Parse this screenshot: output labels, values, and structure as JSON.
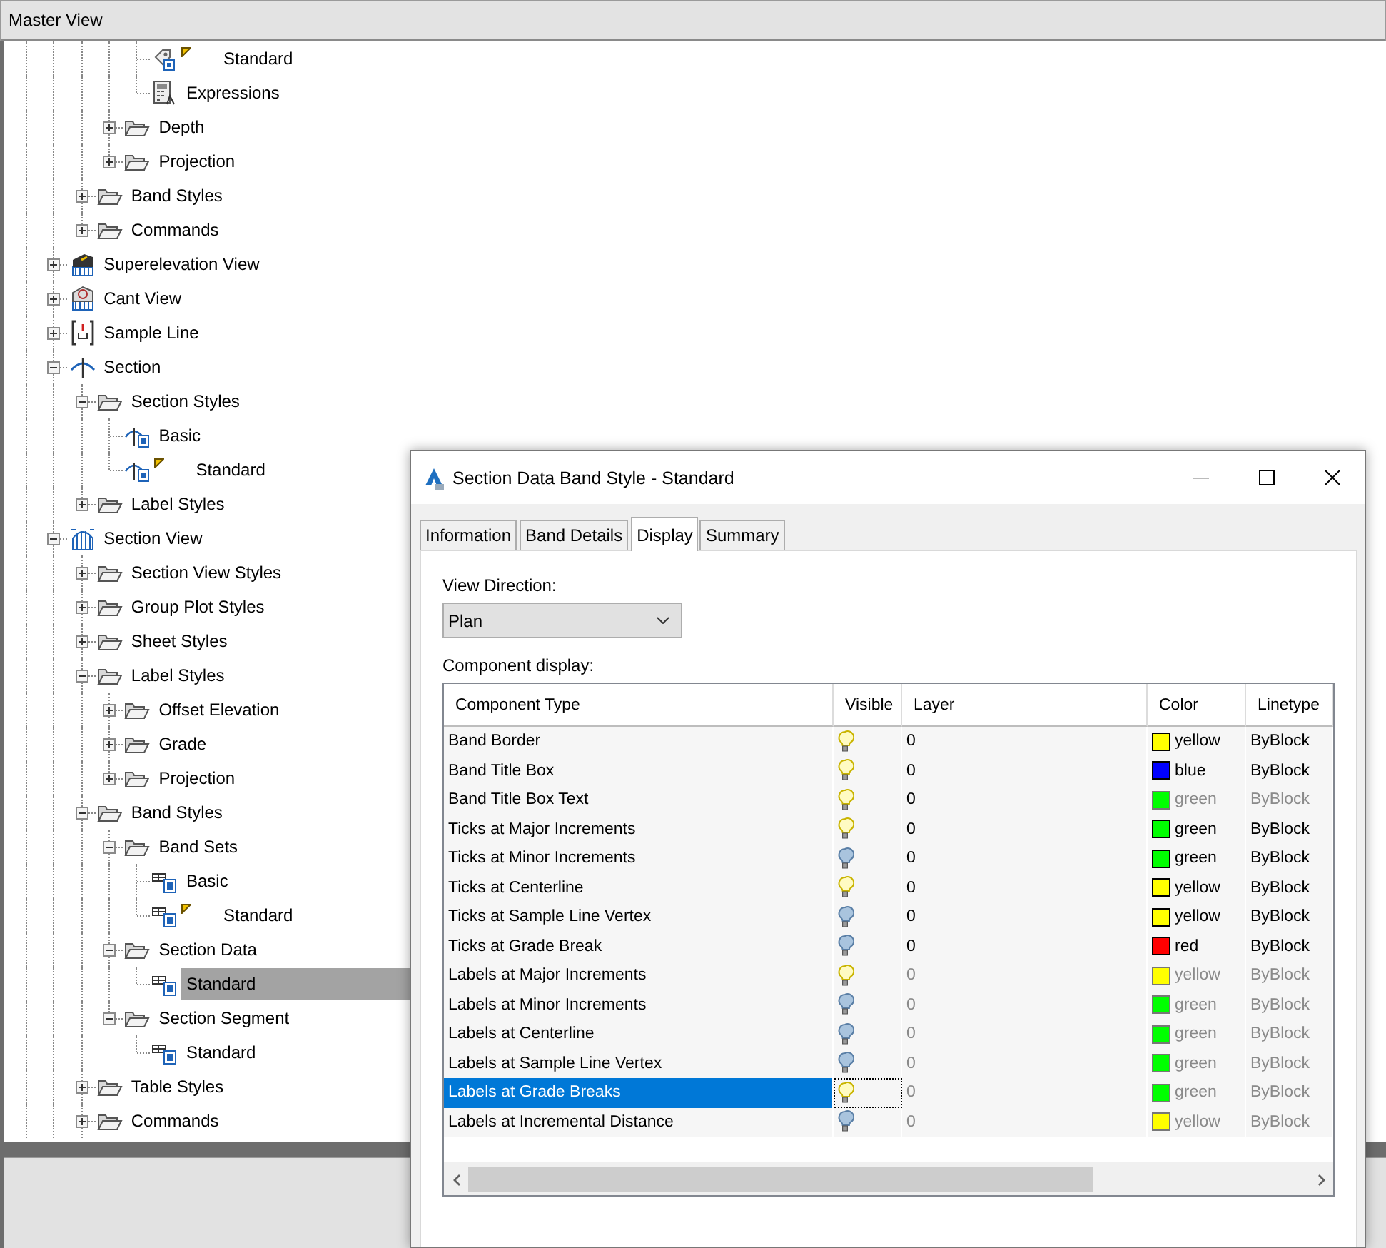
{
  "panel": {
    "title": "Master View"
  },
  "tree": {
    "items": [
      {
        "children": [
          {
            "children": [
              {
                "children": [
                  {
                    "label": "Standard",
                    "kind": "style",
                    "marked": true,
                    "selected": false
                  },
                  {
                    "label": "Expressions",
                    "kind": "expressions",
                    "marked": false,
                    "selected": false
                  }
                ]
              },
              {
                "label": "Depth",
                "kind": "folder",
                "expanded": false,
                "marked": false,
                "selected": false
              },
              {
                "label": "Projection",
                "kind": "folder",
                "expanded": false,
                "marked": false,
                "selected": false
              }
            ]
          },
          {
            "label": "Band Styles",
            "kind": "folder",
            "expanded": false,
            "marked": false,
            "selected": false
          },
          {
            "label": "Commands",
            "kind": "folder",
            "expanded": false,
            "marked": false,
            "selected": false
          }
        ]
      },
      {
        "label": "Superelevation View",
        "kind": "superelevation-view",
        "expanded": false,
        "marked": false,
        "selected": false
      },
      {
        "label": "Cant View",
        "kind": "cant-view",
        "expanded": false,
        "marked": false,
        "selected": false
      },
      {
        "label": "Sample Line",
        "kind": "sample-line",
        "expanded": false,
        "marked": false,
        "selected": false
      },
      {
        "label": "Section",
        "kind": "section",
        "expanded": true,
        "marked": false,
        "selected": false,
        "children": [
          {
            "label": "Section Styles",
            "kind": "folder",
            "expanded": true,
            "marked": false,
            "selected": false,
            "children": [
              {
                "label": "Basic",
                "kind": "section-style",
                "marked": false,
                "selected": false
              },
              {
                "label": "Standard",
                "kind": "section-style",
                "marked": true,
                "selected": false
              }
            ]
          },
          {
            "label": "Label Styles",
            "kind": "folder",
            "expanded": false,
            "marked": false,
            "selected": false
          }
        ]
      },
      {
        "label": "Section View",
        "kind": "section-view",
        "expanded": true,
        "marked": false,
        "selected": false,
        "children": [
          {
            "label": "Section View Styles",
            "kind": "folder",
            "expanded": false,
            "marked": false,
            "selected": false
          },
          {
            "label": "Group Plot Styles",
            "kind": "folder",
            "expanded": false,
            "marked": false,
            "selected": false
          },
          {
            "label": "Sheet Styles",
            "kind": "folder",
            "expanded": false,
            "marked": false,
            "selected": false
          },
          {
            "label": "Label Styles",
            "kind": "folder",
            "expanded": true,
            "marked": false,
            "selected": false,
            "children": [
              {
                "label": "Offset Elevation",
                "kind": "folder",
                "expanded": false,
                "marked": false,
                "selected": false
              },
              {
                "label": "Grade",
                "kind": "folder",
                "expanded": false,
                "marked": false,
                "selected": false
              },
              {
                "label": "Projection",
                "kind": "folder",
                "expanded": false,
                "marked": false,
                "selected": false
              }
            ]
          },
          {
            "label": "Band Styles",
            "kind": "folder",
            "expanded": true,
            "marked": false,
            "selected": false,
            "children": [
              {
                "label": "Band Sets",
                "kind": "folder",
                "expanded": true,
                "marked": false,
                "selected": false,
                "children": [
                  {
                    "label": "Basic",
                    "kind": "band-set",
                    "marked": false,
                    "selected": false
                  },
                  {
                    "label": "Standard",
                    "kind": "band-set",
                    "marked": true,
                    "selected": false
                  }
                ]
              },
              {
                "label": "Section Data",
                "kind": "folder",
                "expanded": true,
                "marked": false,
                "selected": false,
                "children": [
                  {
                    "label": "Standard",
                    "kind": "band-set",
                    "marked": false,
                    "selected": true
                  }
                ]
              },
              {
                "label": "Section Segment",
                "kind": "folder",
                "expanded": true,
                "marked": false,
                "selected": false,
                "children": [
                  {
                    "label": "Standard",
                    "kind": "band-set",
                    "marked": false,
                    "selected": false
                  }
                ]
              }
            ]
          },
          {
            "label": "Table Styles",
            "kind": "folder",
            "expanded": false,
            "marked": false,
            "selected": false
          },
          {
            "label": "Commands",
            "kind": "folder",
            "expanded": false,
            "marked": false,
            "selected": false
          }
        ]
      }
    ]
  },
  "dialog": {
    "title": "Section Data Band Style - Standard",
    "tabs": [
      {
        "label": "Information",
        "selected": false
      },
      {
        "label": "Band Details",
        "selected": false
      },
      {
        "label": "Display",
        "selected": true
      },
      {
        "label": "Summary",
        "selected": false
      }
    ],
    "view_direction": {
      "label": "View Direction:",
      "value": "Plan"
    },
    "component_display": {
      "label": "Component display:",
      "columns": [
        "Component Type",
        "Visible",
        "Layer",
        "Color",
        "Linetype"
      ],
      "rows": [
        {
          "name": "Band Border",
          "visible": true,
          "layer": "0",
          "color_name": "yellow",
          "color": "#ffff00",
          "linetype": "ByBlock",
          "layer_disabled": false,
          "properties_disabled": false,
          "selected": false
        },
        {
          "name": "Band Title Box",
          "visible": true,
          "layer": "0",
          "color_name": "blue",
          "color": "#0000ff",
          "linetype": "ByBlock",
          "layer_disabled": false,
          "properties_disabled": false,
          "selected": false
        },
        {
          "name": "Band Title Box Text",
          "visible": true,
          "layer": "0",
          "color_name": "green",
          "color": "#00ff00",
          "linetype": "ByBlock",
          "layer_disabled": false,
          "properties_disabled": true,
          "selected": false
        },
        {
          "name": "Ticks at Major Increments",
          "visible": true,
          "layer": "0",
          "color_name": "green",
          "color": "#00ff00",
          "linetype": "ByBlock",
          "layer_disabled": false,
          "properties_disabled": false,
          "selected": false
        },
        {
          "name": "Ticks at Minor Increments",
          "visible": false,
          "layer": "0",
          "color_name": "green",
          "color": "#00ff00",
          "linetype": "ByBlock",
          "layer_disabled": false,
          "properties_disabled": false,
          "selected": false
        },
        {
          "name": "Ticks at Centerline",
          "visible": true,
          "layer": "0",
          "color_name": "yellow",
          "color": "#ffff00",
          "linetype": "ByBlock",
          "layer_disabled": false,
          "properties_disabled": false,
          "selected": false
        },
        {
          "name": "Ticks at Sample Line Vertex",
          "visible": false,
          "layer": "0",
          "color_name": "yellow",
          "color": "#ffff00",
          "linetype": "ByBlock",
          "layer_disabled": false,
          "properties_disabled": false,
          "selected": false
        },
        {
          "name": "Ticks at Grade Break",
          "visible": false,
          "layer": "0",
          "color_name": "red",
          "color": "#ff0000",
          "linetype": "ByBlock",
          "layer_disabled": false,
          "properties_disabled": false,
          "selected": false
        },
        {
          "name": "Labels at Major Increments",
          "visible": true,
          "layer": "0",
          "color_name": "yellow",
          "color": "#ffff00",
          "linetype": "ByBlock",
          "layer_disabled": true,
          "properties_disabled": true,
          "selected": false
        },
        {
          "name": "Labels at Minor Increments",
          "visible": false,
          "layer": "0",
          "color_name": "green",
          "color": "#00ff00",
          "linetype": "ByBlock",
          "layer_disabled": true,
          "properties_disabled": true,
          "selected": false
        },
        {
          "name": "Labels at Centerline",
          "visible": false,
          "layer": "0",
          "color_name": "green",
          "color": "#00ff00",
          "linetype": "ByBlock",
          "layer_disabled": true,
          "properties_disabled": true,
          "selected": false
        },
        {
          "name": "Labels at Sample Line Vertex",
          "visible": false,
          "layer": "0",
          "color_name": "green",
          "color": "#00ff00",
          "linetype": "ByBlock",
          "layer_disabled": true,
          "properties_disabled": true,
          "selected": false
        },
        {
          "name": "Labels at Grade Breaks",
          "visible": true,
          "layer": "0",
          "color_name": "green",
          "color": "#00ff00",
          "linetype": "ByBlock",
          "layer_disabled": true,
          "properties_disabled": true,
          "selected": true
        },
        {
          "name": "Labels at Incremental Distance",
          "visible": false,
          "layer": "0",
          "color_name": "yellow",
          "color": "#ffff00",
          "linetype": "ByBlock",
          "layer_disabled": true,
          "properties_disabled": true,
          "selected": false
        }
      ]
    }
  }
}
